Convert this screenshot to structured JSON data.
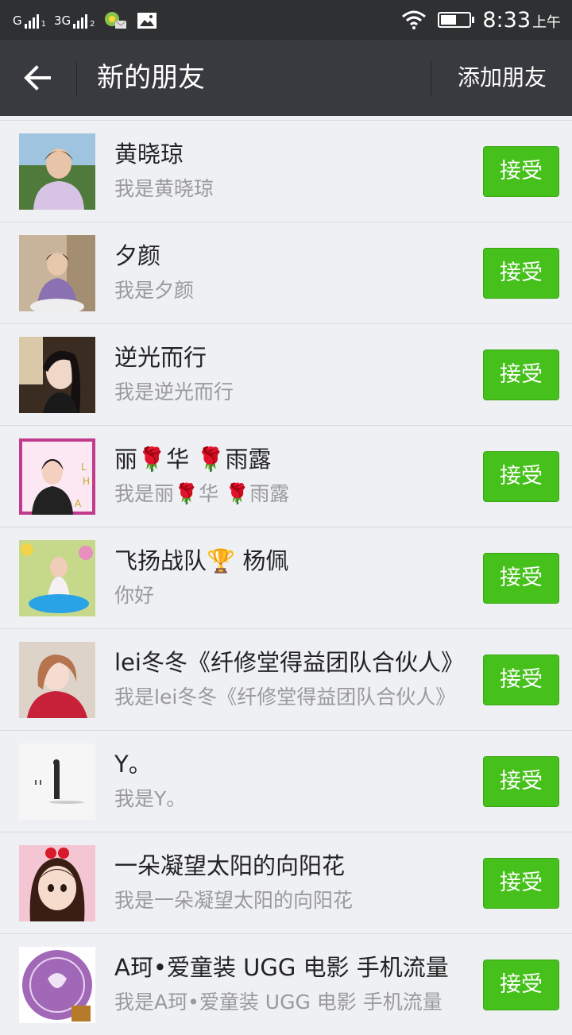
{
  "status_bar": {
    "carrier1": "G",
    "carrier1_sub": "1",
    "carrier2": "3G",
    "carrier2_sub": "2",
    "time": "8:33",
    "ampm": "上午",
    "battery_level": 0.55,
    "icons": [
      "signal-bars-icon",
      "notification-app-icon",
      "gallery-icon",
      "wifi-icon",
      "battery-icon"
    ]
  },
  "header": {
    "back_icon": "arrow-left-icon",
    "title": "新的朋友",
    "add_friend": "添加朋友"
  },
  "colors": {
    "status_bar_bg": "#2e3032",
    "title_bar_bg": "#393a3f",
    "list_bg": "#eef0f3",
    "accept_green": "#46c01b",
    "name_text": "#222222",
    "message_text": "#9a9a9a"
  },
  "friend_requests": [
    {
      "name": "黄晓琼",
      "message": "我是黄晓琼",
      "button": "接受"
    },
    {
      "name": "夕颜",
      "message": "我是夕颜",
      "button": "接受"
    },
    {
      "name": "逆光而行",
      "message": "我是逆光而行",
      "button": "接受"
    },
    {
      "name": "丽🌹华 🌹雨露",
      "message": "我是丽🌹华 🌹雨露",
      "button": "接受"
    },
    {
      "name": "飞扬战队🏆 杨佩",
      "message": "你好",
      "button": "接受"
    },
    {
      "name": "lei冬冬《纤修堂得益团队合伙人》",
      "message": "我是lei冬冬《纤修堂得益团队合伙人》",
      "button": "接受"
    },
    {
      "name": "Y。",
      "message": "我是Y。",
      "button": "接受"
    },
    {
      "name": "一朵凝望太阳的向阳花",
      "message": "我是一朵凝望太阳的向阳花",
      "button": "接受"
    },
    {
      "name": "A珂•爱童装 UGG 电影 手机流量",
      "message": "我是A珂•爱童装 UGG 电影 手机流量",
      "button": "接受"
    }
  ]
}
